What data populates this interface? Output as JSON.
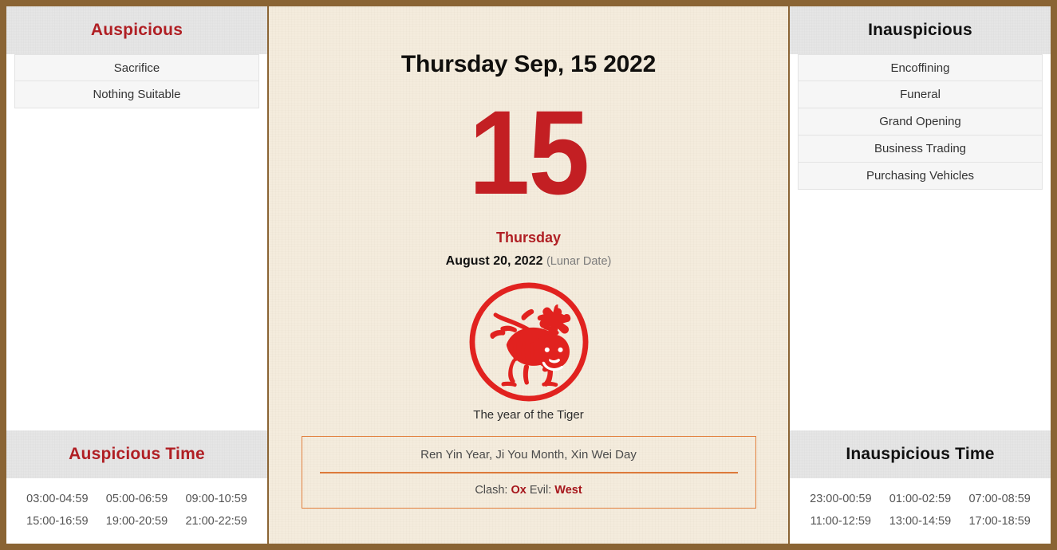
{
  "theme": {
    "frame_border": "#8a6434",
    "accent_red": "#b01f24",
    "big_day_red": "#c31f23",
    "paper_bg": "#f4ecdd",
    "header_bg": "#e6e6e6",
    "info_border": "#e2813f"
  },
  "left_panel": {
    "header": "Auspicious",
    "items": [
      "Sacrifice",
      "Nothing Suitable"
    ],
    "time_header": "Auspicious Time",
    "times": [
      "03:00-04:59",
      "05:00-06:59",
      "09:00-10:59",
      "15:00-16:59",
      "19:00-20:59",
      "21:00-22:59"
    ]
  },
  "center_panel": {
    "title": "Thursday Sep, 15 2022",
    "day_number": "15",
    "weekday": "Thursday",
    "lunar_date": "August 20, 2022",
    "lunar_note": "(Lunar Date)",
    "zodiac_icon": "tiger-papercut-icon",
    "zodiac_caption": "The year of the Tiger",
    "ganzhi": "Ren Yin Year, Ji You Month, Xin Wei Day",
    "clash_label": "Clash:",
    "clash_value": "Ox",
    "evil_label": "Evil:",
    "evil_value": "West"
  },
  "right_panel": {
    "header": "Inauspicious",
    "items": [
      "Encoffining",
      "Funeral",
      "Grand Opening",
      "Business Trading",
      "Purchasing Vehicles"
    ],
    "time_header": "Inauspicious Time",
    "times": [
      "23:00-00:59",
      "01:00-02:59",
      "07:00-08:59",
      "11:00-12:59",
      "13:00-14:59",
      "17:00-18:59"
    ]
  }
}
